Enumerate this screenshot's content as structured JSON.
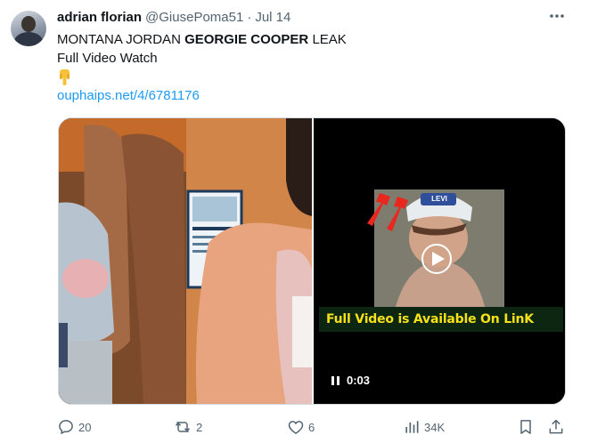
{
  "author": {
    "display_name": "adrian florian",
    "handle": "@GiusePoma51",
    "separator": "·",
    "date": "Jul 14"
  },
  "tweet": {
    "line1_prefix": "MONTANA JORDAN ",
    "line1_bold": "GEORGIE COOPER",
    "line1_suffix": " LEAK",
    "line2": "Full Video Watch",
    "emoji_icon": "backhand-index-pointing-down-icon",
    "link": "ouphaips.net/4/6781176"
  },
  "video": {
    "banner_text": "Full Video is Available On LinK",
    "timestamp": "0:03",
    "cap_text": "LEVI"
  },
  "actions": {
    "replies": "20",
    "reposts": "2",
    "likes": "6",
    "views": "34K"
  },
  "colors": {
    "link": "#1d9bf0",
    "secondary_text": "#536471",
    "banner_text": "#f5e11a",
    "arrow_red": "#e8281e"
  }
}
